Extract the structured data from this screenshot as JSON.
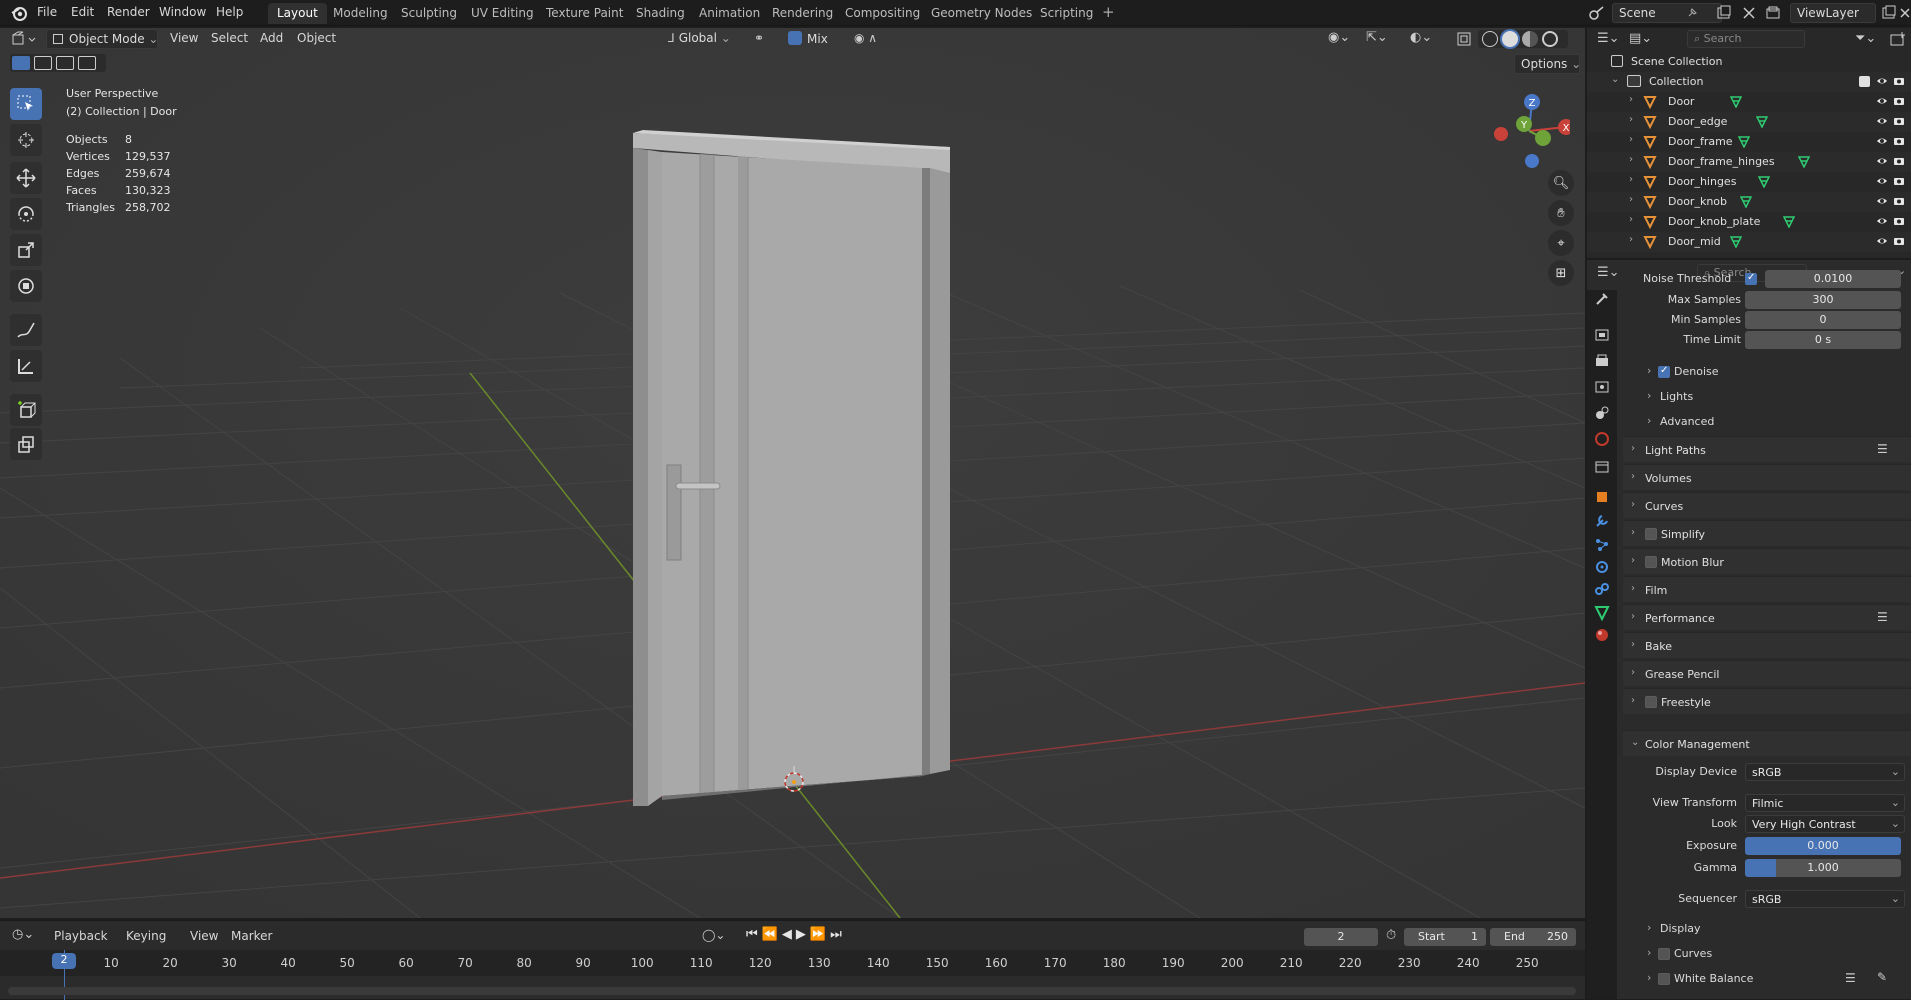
{
  "topbar": {
    "menus": [
      "File",
      "Edit",
      "Render",
      "Window",
      "Help"
    ],
    "workspaces": [
      "Layout",
      "Modeling",
      "Sculpting",
      "UV Editing",
      "Texture Paint",
      "Shading",
      "Animation",
      "Rendering",
      "Compositing",
      "Geometry Nodes",
      "Scripting"
    ],
    "active_workspace": "Layout",
    "add_tab": "+",
    "scene": "Scene",
    "view_layer": "ViewLayer"
  },
  "viewport": {
    "mode": "Object Mode",
    "menus": [
      "View",
      "Select",
      "Add",
      "Object"
    ],
    "orientation": "Global",
    "snap": "Mix",
    "options": "Options",
    "perspective": "User Perspective",
    "context": "(2) Collection | Door",
    "stats": [
      {
        "label": "Objects",
        "value": "8"
      },
      {
        "label": "Vertices",
        "value": "129,537"
      },
      {
        "label": "Edges",
        "value": "259,674"
      },
      {
        "label": "Faces",
        "value": "130,323"
      },
      {
        "label": "Triangles",
        "value": "258,702"
      }
    ],
    "gizmo": {
      "x": "X",
      "y": "Y",
      "z": "Z"
    }
  },
  "outliner": {
    "search_placeholder": "Search",
    "scene_collection": "Scene Collection",
    "collection": "Collection",
    "objects": [
      "Door",
      "Door_edge",
      "Door_frame",
      "Door_frame_hinges",
      "Door_hinges",
      "Door_knob",
      "Door_knob_plate",
      "Door_mid"
    ]
  },
  "properties": {
    "search_placeholder": "Search",
    "noise_threshold": {
      "label": "Noise Threshold",
      "value": "0.0100"
    },
    "max_samples": {
      "label": "Max Samples",
      "value": "300"
    },
    "min_samples": {
      "label": "Min Samples",
      "value": "0"
    },
    "time_limit": {
      "label": "Time Limit",
      "value": "0 s"
    },
    "denoise": "Denoise",
    "lights": "Lights",
    "advanced": "Advanced",
    "panels": [
      "Light Paths",
      "Volumes",
      "Curves",
      "Simplify",
      "Motion Blur",
      "Film",
      "Performance",
      "Bake",
      "Grease Pencil",
      "Freestyle"
    ],
    "color_management": {
      "title": "Color Management",
      "display_device": {
        "label": "Display Device",
        "value": "sRGB"
      },
      "view_transform": {
        "label": "View Transform",
        "value": "Filmic"
      },
      "look": {
        "label": "Look",
        "value": "Very High Contrast"
      },
      "exposure": {
        "label": "Exposure",
        "value": "0.000"
      },
      "gamma": {
        "label": "Gamma",
        "value": "1.000"
      },
      "sequencer": {
        "label": "Sequencer",
        "value": "sRGB"
      },
      "display": "Display",
      "curves": "Curves",
      "white_balance": "White Balance"
    }
  },
  "timeline": {
    "menus": [
      "Playback",
      "Keying",
      "View",
      "Marker"
    ],
    "current_frame": "2",
    "start_label": "Start",
    "start": "1",
    "end_label": "End",
    "end": "250",
    "ticks": [
      "10",
      "20",
      "30",
      "40",
      "50",
      "60",
      "70",
      "80",
      "90",
      "100",
      "110",
      "120",
      "130",
      "140",
      "150",
      "160",
      "170",
      "180",
      "190",
      "200",
      "210",
      "220",
      "230",
      "240",
      "250"
    ],
    "playhead_label": "2"
  }
}
